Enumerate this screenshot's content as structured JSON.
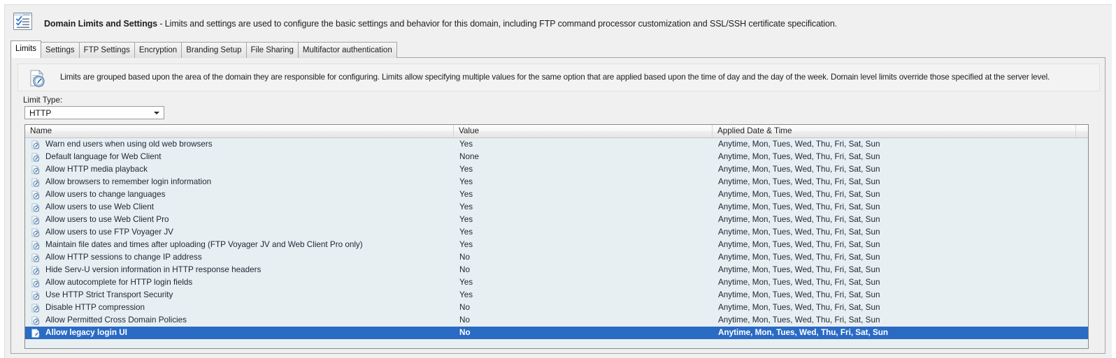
{
  "window": {
    "icon": "settings-list-icon",
    "title_bold": "Domain Limits and Settings",
    "title_rest": " - Limits and settings are used to configure the basic settings and behavior for this domain, including FTP command processor customization and SSL/SSH certificate specification."
  },
  "tabs": [
    {
      "label": "Limits",
      "active": true
    },
    {
      "label": "Settings",
      "active": false
    },
    {
      "label": "FTP Settings",
      "active": false
    },
    {
      "label": "Encryption",
      "active": false
    },
    {
      "label": "Branding Setup",
      "active": false
    },
    {
      "label": "File Sharing",
      "active": false
    },
    {
      "label": "Multifactor authentication",
      "active": false
    }
  ],
  "info": {
    "icon": "document-clock-icon",
    "text": "Limits are grouped based upon the area of the domain they are responsible for configuring. Limits allow specifying multiple values for the same option that are applied based upon the time of day and the day of the week. Domain level limits override those specified at the server level."
  },
  "limit_type": {
    "label": "Limit Type:",
    "value": "HTTP",
    "options": [
      "HTTP"
    ]
  },
  "grid": {
    "columns": [
      {
        "key": "name",
        "label": "Name"
      },
      {
        "key": "value",
        "label": "Value"
      },
      {
        "key": "date",
        "label": "Applied Date & Time"
      }
    ],
    "default_schedule": "Anytime, Mon, Tues, Wed, Thu, Fri, Sat, Sun",
    "rows": [
      {
        "icon": "limit-item-icon",
        "name": "Warn end users when using old web browsers",
        "value": "Yes",
        "date": "Anytime, Mon, Tues, Wed, Thu, Fri, Sat, Sun",
        "selected": false
      },
      {
        "icon": "limit-item-icon",
        "name": "Default language for Web Client",
        "value": "None",
        "date": "Anytime, Mon, Tues, Wed, Thu, Fri, Sat, Sun",
        "selected": false
      },
      {
        "icon": "limit-item-icon",
        "name": "Allow HTTP media playback",
        "value": "Yes",
        "date": "Anytime, Mon, Tues, Wed, Thu, Fri, Sat, Sun",
        "selected": false
      },
      {
        "icon": "limit-item-icon",
        "name": "Allow browsers to remember login information",
        "value": "Yes",
        "date": "Anytime, Mon, Tues, Wed, Thu, Fri, Sat, Sun",
        "selected": false
      },
      {
        "icon": "limit-item-icon",
        "name": "Allow users to change languages",
        "value": "Yes",
        "date": "Anytime, Mon, Tues, Wed, Thu, Fri, Sat, Sun",
        "selected": false
      },
      {
        "icon": "limit-item-icon",
        "name": "Allow users to use Web Client",
        "value": "Yes",
        "date": "Anytime, Mon, Tues, Wed, Thu, Fri, Sat, Sun",
        "selected": false
      },
      {
        "icon": "limit-item-icon",
        "name": "Allow users to use Web Client Pro",
        "value": "Yes",
        "date": "Anytime, Mon, Tues, Wed, Thu, Fri, Sat, Sun",
        "selected": false
      },
      {
        "icon": "limit-item-icon",
        "name": "Allow users to use FTP Voyager JV",
        "value": "Yes",
        "date": "Anytime, Mon, Tues, Wed, Thu, Fri, Sat, Sun",
        "selected": false
      },
      {
        "icon": "limit-item-icon",
        "name": "Maintain file dates and times after uploading (FTP Voyager JV and Web Client Pro only)",
        "value": "Yes",
        "date": "Anytime, Mon, Tues, Wed, Thu, Fri, Sat, Sun",
        "selected": false
      },
      {
        "icon": "limit-item-icon",
        "name": "Allow HTTP sessions to change IP address",
        "value": "No",
        "date": "Anytime, Mon, Tues, Wed, Thu, Fri, Sat, Sun",
        "selected": false
      },
      {
        "icon": "limit-item-icon",
        "name": "Hide Serv-U version information in HTTP response headers",
        "value": "No",
        "date": "Anytime, Mon, Tues, Wed, Thu, Fri, Sat, Sun",
        "selected": false
      },
      {
        "icon": "limit-item-icon",
        "name": "Allow autocomplete for HTTP login fields",
        "value": "Yes",
        "date": "Anytime, Mon, Tues, Wed, Thu, Fri, Sat, Sun",
        "selected": false
      },
      {
        "icon": "limit-item-icon",
        "name": "Use HTTP Strict Transport Security",
        "value": "Yes",
        "date": "Anytime, Mon, Tues, Wed, Thu, Fri, Sat, Sun",
        "selected": false
      },
      {
        "icon": "limit-item-icon",
        "name": "Disable HTTP compression",
        "value": "No",
        "date": "Anytime, Mon, Tues, Wed, Thu, Fri, Sat, Sun",
        "selected": false
      },
      {
        "icon": "limit-item-icon",
        "name": "Allow Permitted Cross Domain Policies",
        "value": "No",
        "date": "Anytime, Mon, Tues, Wed, Thu, Fri, Sat, Sun",
        "selected": false
      },
      {
        "icon": "limit-item-icon-selected",
        "name": "Allow legacy login UI",
        "value": "No",
        "date": "Anytime, Mon, Tues, Wed, Thu, Fri, Sat, Sun",
        "selected": true
      }
    ]
  },
  "colors": {
    "selection_blue": "#2a6bc4",
    "grid_background": "#e8eff2",
    "panel_background": "#f0f0f0",
    "border": "#8a8a8a"
  }
}
